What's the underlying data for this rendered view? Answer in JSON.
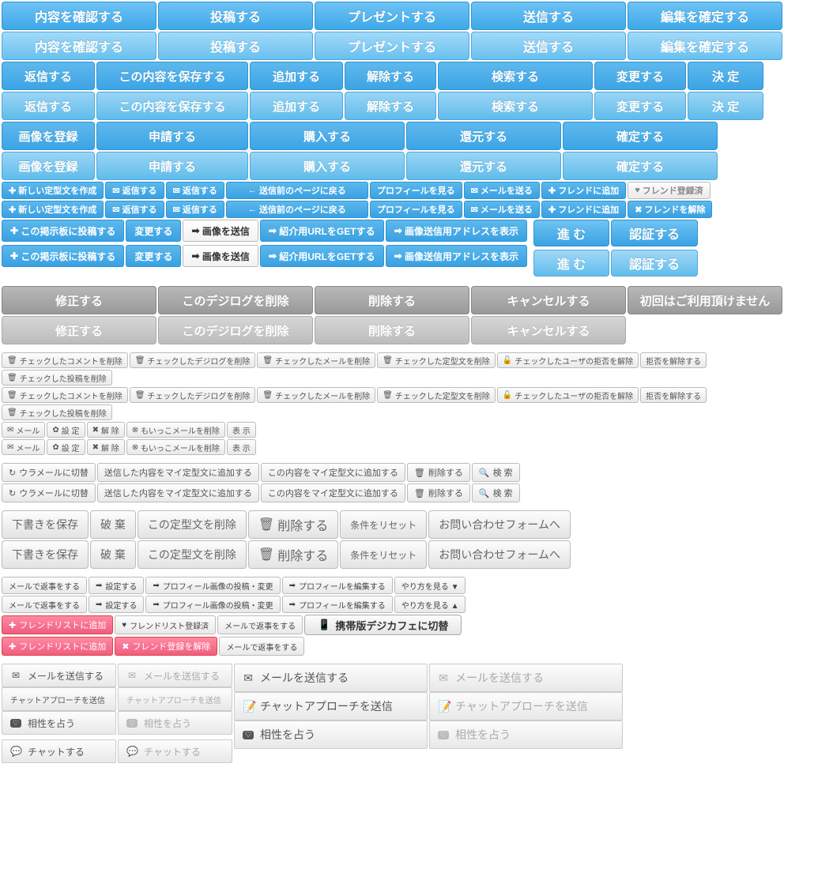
{
  "r1": {
    "confirm": "内容を確認する",
    "post": "投稿する",
    "present": "プレゼントする",
    "send": "送信する",
    "commit": "編集を確定する"
  },
  "r2": {
    "reply": "返信する",
    "save": "この内容を保存する",
    "add": "追加する",
    "release": "解除する",
    "search": "検索する",
    "change": "変更する",
    "decide": "決 定"
  },
  "r3": {
    "image": "画像を登録",
    "apply": "申請する",
    "buy": "購入する",
    "restore": "還元する",
    "fix": "確定する"
  },
  "s": {
    "new": "新しい定型文を作成",
    "replyA": "返信する",
    "replyB": "返信する",
    "back": "送信前のページに戻る",
    "profile": "プロフィールを見る",
    "mail": "メールを送る",
    "friendadd": "フレンドに追加",
    "friendregd": "フレンド登録済",
    "friendrel": "フレンドを解除"
  },
  "a": {
    "postbb": "この掲示板に投稿する",
    "change": "変更する",
    "imgsend": "画像を送信",
    "url": "紹介用URLをGETする",
    "addr": "画像送信用アドレスを表示",
    "next": "進 む",
    "auth": "認証する"
  },
  "g": {
    "fix": "修正する",
    "del1": "このデジログを削除",
    "del2": "削除する",
    "cancel": "キャンセルする",
    "first": "初回はご利用頂けません"
  },
  "c": {
    "dcom": "チェックしたコメントを削除",
    "ddig": "チェックしたデジログを削除",
    "dmail": "チェックしたメールを削除",
    "dtei": "チェックした定型文を削除",
    "ureject": "チェックしたユーザの拒否を解除",
    "reject": "拒否を解除する",
    "dpost": "チェックした投稿を削除",
    "mail": "メール",
    "set": "設 定",
    "rel": "解 除",
    "delmore": "もいっこメールを削除",
    "show": "表 示"
  },
  "u": {
    "ura": "ウラメールに切替",
    "sentadd": "送信した内容をマイ定型文に追加する",
    "thisadd": "この内容をマイ定型文に追加する",
    "del": "削除する",
    "search": "検 索"
  },
  "m": {
    "draft": "下書きを保存",
    "discard": "破 棄",
    "deltei": "この定型文を削除",
    "del": "削除する",
    "reset": "条件をリセット",
    "contact": "お問い合わせフォームへ"
  },
  "w": {
    "mailreply": "メールで返事をする",
    "setto": "設定する",
    "profimg": "プロフィール画像の投稿・変更",
    "profedit": "プロフィールを編集する",
    "howdown": "やり方を見る ▼",
    "howup": "やり方を見る ▲"
  },
  "p": {
    "fadd": "フレンドリストに追加",
    "freg": "フレンドリスト登録済",
    "frel": "フレンド登録を解除",
    "mreply": "メールで返事をする",
    "mob": "携帯版デジカフェに切替"
  },
  "L": {
    "mail": "メールを送信する",
    "chat": "チャットアプローチを送信",
    "ai": "相性を占う",
    "chat2": "チャットする"
  }
}
